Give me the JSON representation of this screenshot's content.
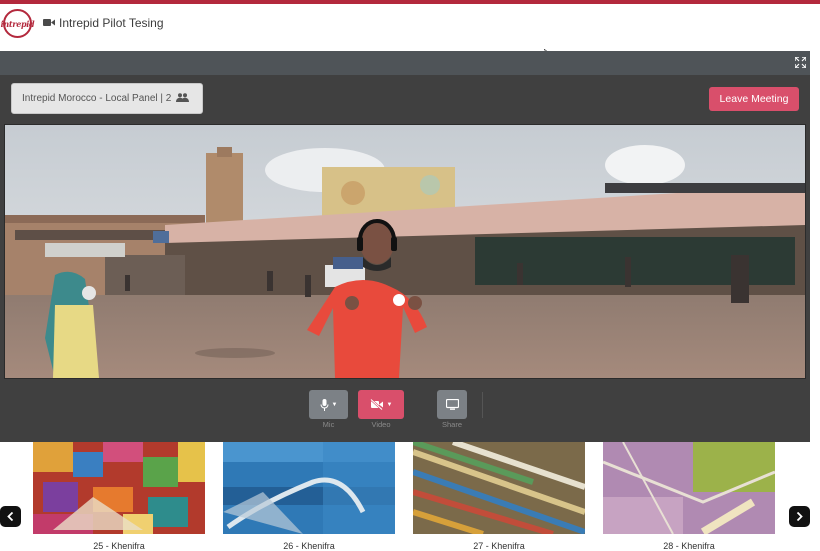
{
  "header": {
    "logo_text": "intrepid",
    "title": "Intrepid Pilot Tesing",
    "icon": "video-camera-icon",
    "accent": "#b3293d"
  },
  "meeting": {
    "room_label": "Intrepid Morocco - Local Panel | 2",
    "room_icon": "group-icon",
    "leave_label": "Leave Meeting",
    "leave_color": "#d94f6b",
    "fullscreen_icon": "expand-icon",
    "controls": [
      {
        "label": "Mic",
        "icon": "microphone-icon"
      },
      {
        "label": "Video",
        "icon": "video-off-icon",
        "color": "#d94f6b"
      },
      {
        "label": "Share",
        "icon": "monitor-icon"
      }
    ]
  },
  "carousel": {
    "items": [
      {
        "caption": "25 - Khenifra"
      },
      {
        "caption": "26 - Khenifra"
      },
      {
        "caption": "27 - Khenifra"
      },
      {
        "caption": "28 - Khenifra"
      }
    ],
    "prev_icon": "chevron-left-icon",
    "next_icon": "chevron-right-icon"
  }
}
